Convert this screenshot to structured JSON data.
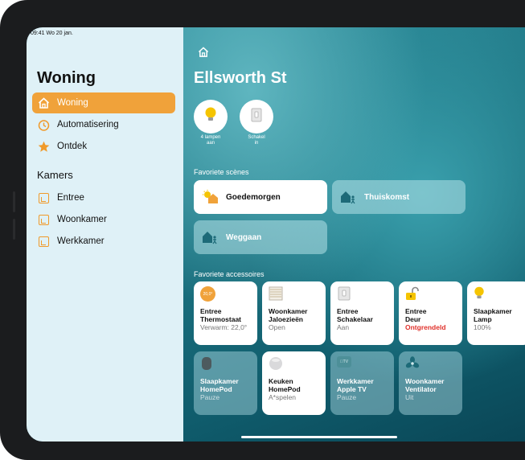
{
  "status_bar": {
    "time_date": "09:41  Wo 20 jan."
  },
  "sidebar": {
    "title": "Woning",
    "nav": [
      {
        "label": "Woning",
        "icon": "house-icon",
        "active": true
      },
      {
        "label": "Automatisering",
        "icon": "clock-icon",
        "active": false
      },
      {
        "label": "Ontdek",
        "icon": "star-icon",
        "active": false
      }
    ],
    "rooms_title": "Kamers",
    "rooms": [
      {
        "label": "Entree"
      },
      {
        "label": "Woonkamer"
      },
      {
        "label": "Werkkamer"
      }
    ]
  },
  "main": {
    "title": "Ellsworth St",
    "status": [
      {
        "line1": "4 lampen",
        "line2": "aan",
        "icon": "lightbulb-icon"
      },
      {
        "line1": "Schakel",
        "line2": "in",
        "icon": "switch-icon"
      }
    ],
    "scenes_title": "Favoriete scènes",
    "scenes": [
      {
        "label": "Goedemorgen",
        "icon": "sunrise-house-icon",
        "state": "on"
      },
      {
        "label": "Thuiskomst",
        "icon": "arrive-home-icon",
        "state": "off"
      },
      {
        "label": "Weggaan",
        "icon": "leave-home-icon",
        "state": "off"
      }
    ],
    "accessories_title": "Favoriete accessoires",
    "accessories": [
      {
        "name1": "Entree",
        "name2": "Thermostaat",
        "status": "Verwarm: 22,0°",
        "icon": "thermostat-icon",
        "badge": "20,0°",
        "state": "on"
      },
      {
        "name1": "Woonkamer",
        "name2": "Jaloezieën",
        "status": "Open",
        "icon": "blinds-icon",
        "state": "on"
      },
      {
        "name1": "Entree",
        "name2": "Schakelaar",
        "status": "Aan",
        "icon": "switch-icon",
        "state": "on"
      },
      {
        "name1": "Entree",
        "name2": "Deur",
        "status": "Ontgrendeld",
        "icon": "unlocked-icon",
        "state": "on",
        "alert": true
      },
      {
        "name1": "Slaapkamer",
        "name2": "Lamp",
        "status": "100%",
        "icon": "lightbulb-icon",
        "state": "on"
      },
      {
        "name1": "Slaapkamer",
        "name2": "HomePod",
        "status": "Pauze",
        "icon": "homepod-icon",
        "state": "off"
      },
      {
        "name1": "Keuken",
        "name2": "HomePod",
        "status": "A*spelen",
        "icon": "homepod-mini-icon",
        "state": "on"
      },
      {
        "name1": "Werkkamer",
        "name2": "Apple TV",
        "status": "Pauze",
        "icon": "appletv-icon",
        "badge": "TV",
        "state": "off"
      },
      {
        "name1": "Woonkamer",
        "name2": "Ventilator",
        "status": "Uit",
        "icon": "fan-icon",
        "state": "off"
      }
    ]
  },
  "colors": {
    "accent": "#f0a23a",
    "sidebar_bg": "#dff1f7",
    "alert": "#e0302a",
    "main_bg": "#1d7482"
  }
}
